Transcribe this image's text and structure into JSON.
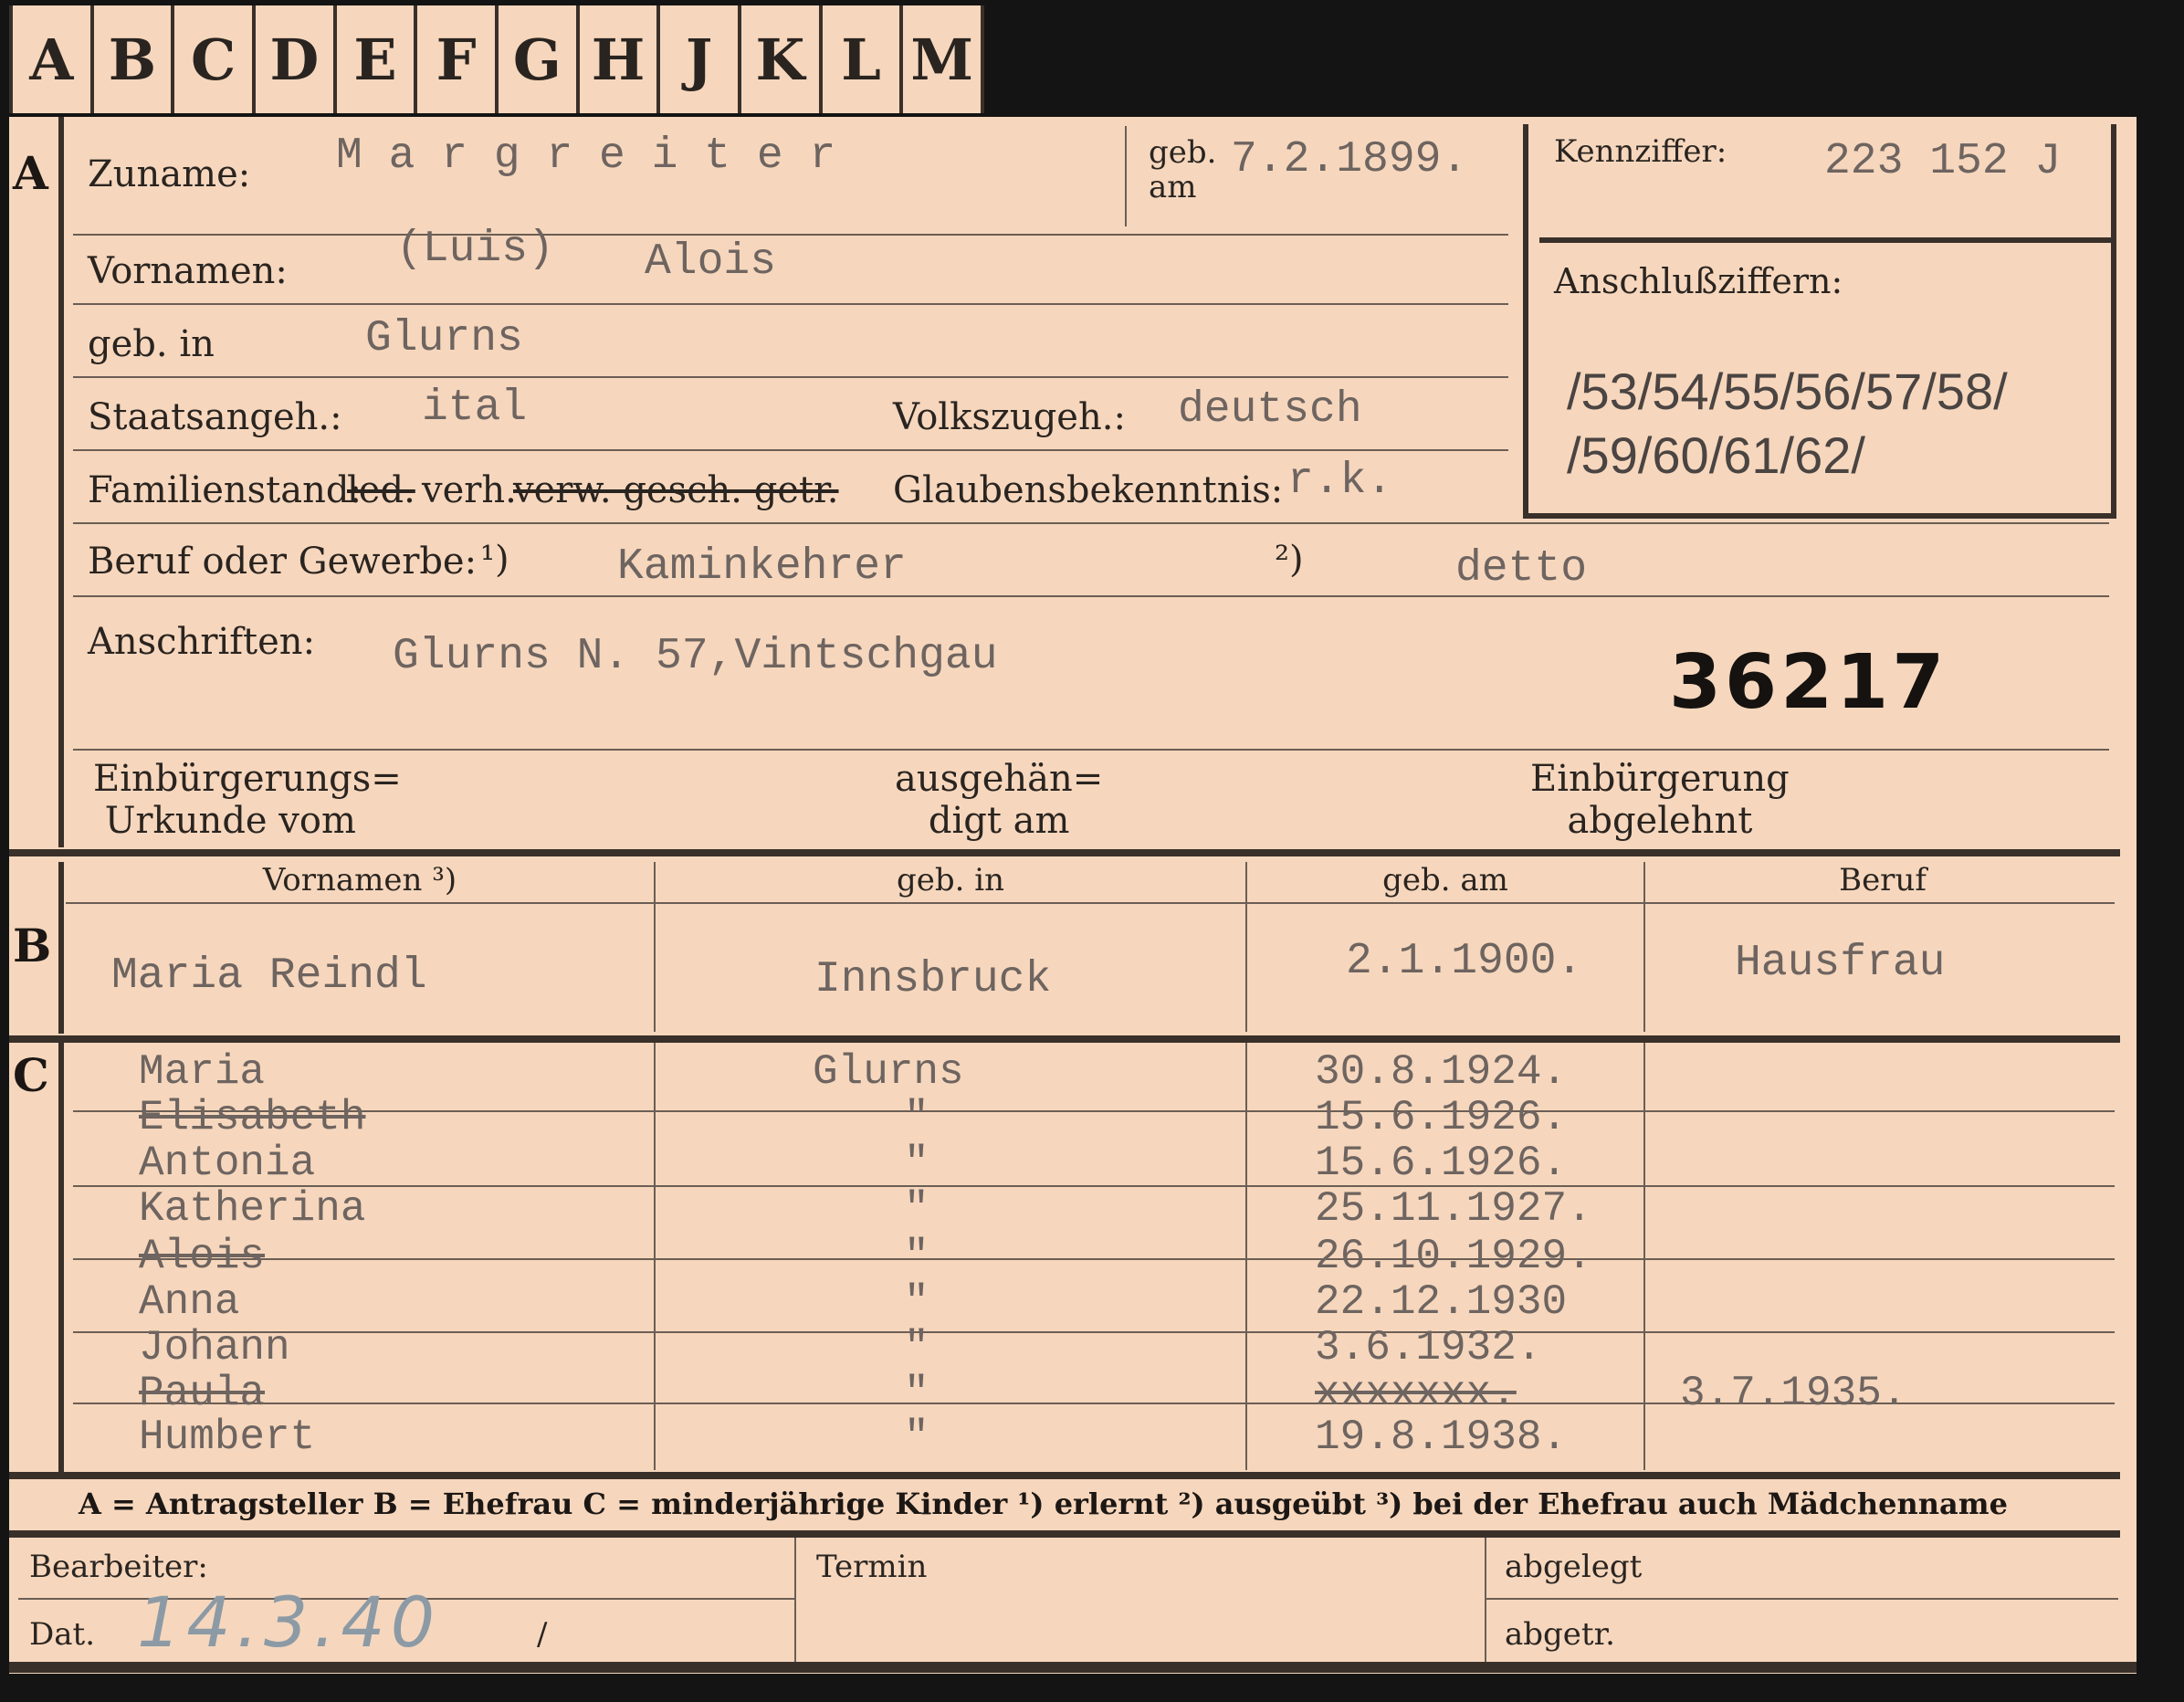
{
  "tabs": [
    "A",
    "B",
    "C",
    "D",
    "E",
    "F",
    "G",
    "H",
    "J",
    "K",
    "L",
    "M"
  ],
  "sections": {
    "a": "A",
    "b": "B",
    "c": "C"
  },
  "surname": {
    "label": "Zuname:",
    "value": "M a r g r e i t e r"
  },
  "born_on": {
    "label_line1": "geb.",
    "label_line2": "am",
    "value": "7.2.1899."
  },
  "id_code": {
    "label": "Kennziffer:",
    "value": "223 152 J"
  },
  "first_names": {
    "label": "Vornamen:",
    "value1": "(Luis)",
    "value2": "Alois"
  },
  "born_in": {
    "label": "geb. in",
    "value": "Glurns"
  },
  "connected_numbers": {
    "label": "Anschlußziffern:",
    "line1": "/53/54/55/56/57/58/",
    "line2": "/59/60/61/62/"
  },
  "nationality": {
    "label": "Staatsangeh.:",
    "value": "ital"
  },
  "ethnicity": {
    "label": "Volkszugeh.:",
    "value": "deutsch"
  },
  "marital": {
    "label": "Familienstand:",
    "opt_led": "led.",
    "opt_verh": "verh.",
    "opt_rest": "verw. gesch. getr."
  },
  "religion": {
    "label": "Glaubensbekenntnis:",
    "value": "r.k."
  },
  "occupation": {
    "label": "Beruf oder Gewerbe:",
    "mark1": "¹)",
    "value1": "Kaminkehrer",
    "mark2": "²)",
    "value2": "detto"
  },
  "address": {
    "label": "Anschriften:",
    "value": "Glurns N. 57,Vintschgau"
  },
  "file_number": "36217",
  "naturalization": {
    "cert_line1": "Einbürgerungs=",
    "cert_line2": "Urkunde vom",
    "handed_line1": "ausgehän=",
    "handed_line2": "digt am",
    "refused_line1": "Einbürgerung",
    "refused_line2": "abgelehnt"
  },
  "spouse_table": {
    "headers": [
      "Vornamen ³)",
      "geb. in",
      "geb. am",
      "Beruf"
    ],
    "row": {
      "name": "Maria Reindl",
      "place": "Innsbruck",
      "date": "2.1.1900.",
      "job": "Hausfrau"
    }
  },
  "children": [
    {
      "name": "Maria",
      "place": "Glurns",
      "date": "30.8.1924.",
      "extra": "",
      "struck": false
    },
    {
      "name": "Elisabeth",
      "place": "\"",
      "date": "15.6.1926.",
      "extra": "",
      "struck": true
    },
    {
      "name": "Antonia",
      "place": "\"",
      "date": "15.6.1926.",
      "extra": "",
      "struck": false
    },
    {
      "name": "Katherina",
      "place": "\"",
      "date": "25.11.1927.",
      "extra": "",
      "struck": false
    },
    {
      "name": "Alois",
      "place": "\"",
      "date": "26.10.1929.",
      "extra": "",
      "struck": true
    },
    {
      "name": "Anna",
      "place": "\"",
      "date": "22.12.1930",
      "extra": "",
      "struck": false
    },
    {
      "name": "Johann",
      "place": "\"",
      "date": "3.6.1932.",
      "extra": "",
      "struck": false
    },
    {
      "name": "Paula",
      "place": "\"",
      "date": "xxxxxxx.",
      "extra": "3.7.1935.",
      "struck": true
    },
    {
      "name": "Humbert",
      "place": "\"",
      "date": "19.8.1938.",
      "extra": "",
      "struck": false
    }
  ],
  "legend": "A = Antragsteller   B = Ehefrau   C = minderjährige Kinder   ¹) erlernt   ²) ausgeübt   ³) bei der Ehefrau auch Mädchenname",
  "footer": {
    "editor_label": "Bearbeiter:",
    "date_label": "Dat.",
    "date_value": "14.3.40",
    "slash": "/",
    "deadline_label": "Termin",
    "filed_label": "abgelegt",
    "sent_label": "abgetr."
  }
}
